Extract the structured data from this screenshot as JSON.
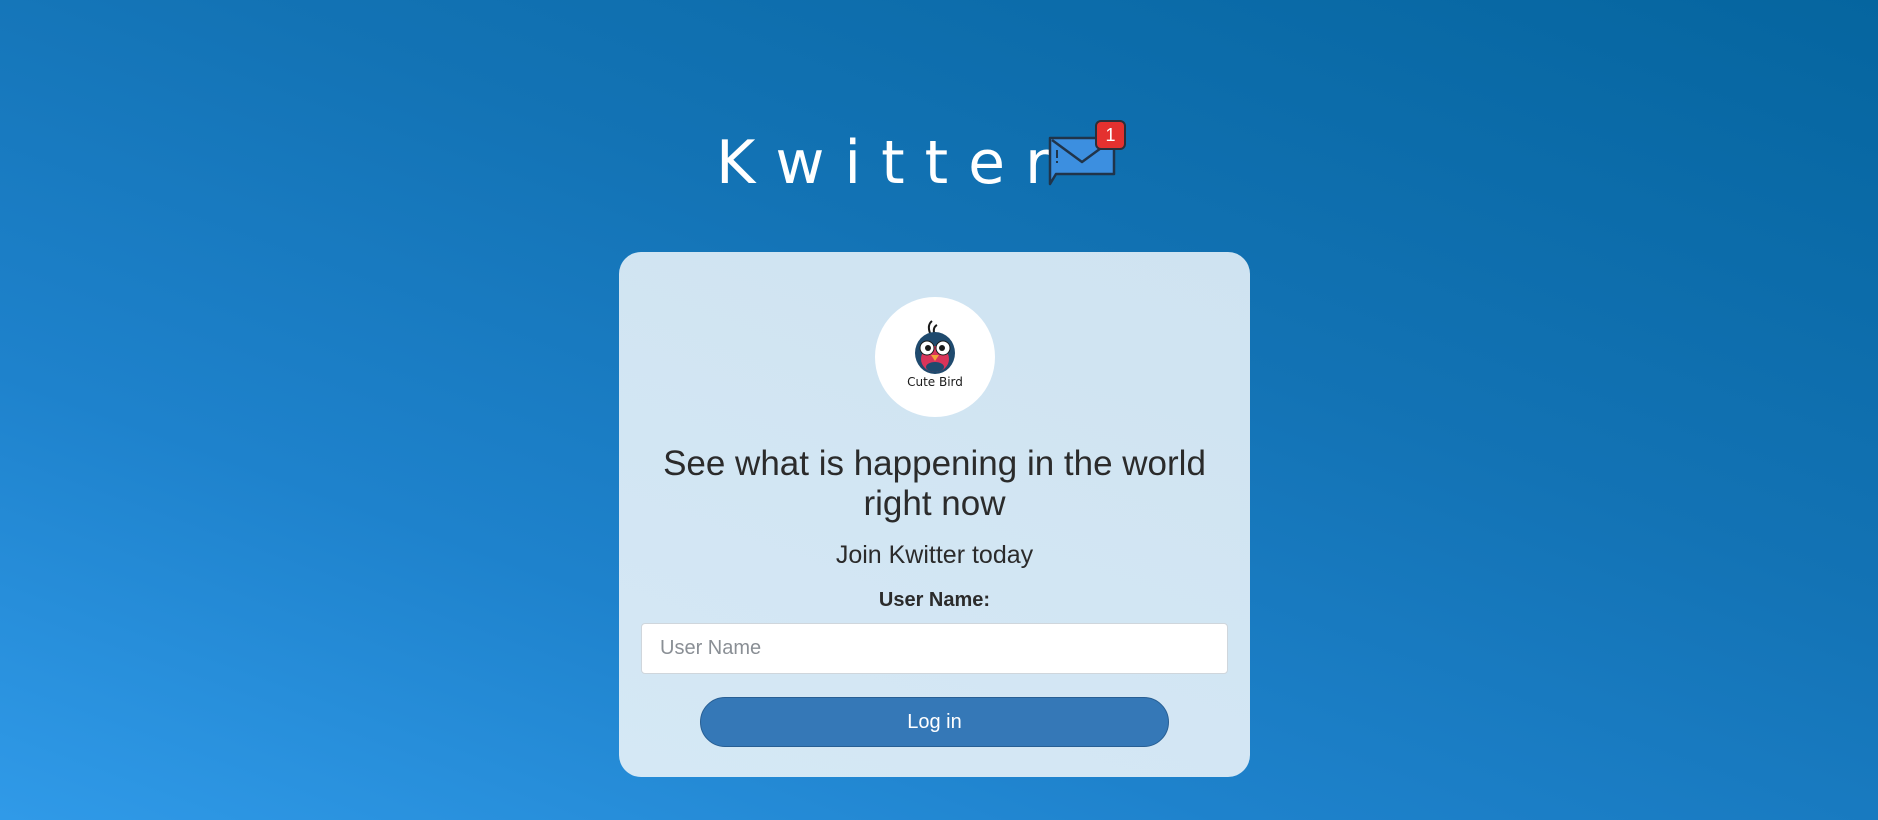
{
  "header": {
    "title": "Kwitter",
    "mail_icon": "envelope-icon",
    "notification_count": "1"
  },
  "card": {
    "avatar": {
      "icon": "cute-bird-logo",
      "caption": "Cute Bird"
    },
    "headline": "See what is happening in the world right now",
    "subhead": "Join Kwitter today",
    "username_label": "User Name:",
    "username_placeholder": "User Name",
    "username_value": "",
    "login_label": "Log in"
  },
  "colors": {
    "background_light": "#309ae8",
    "background_dark": "#05659f",
    "card": "#d3e6f3",
    "button": "#3578b7",
    "badge": "#e4312f",
    "envelope": "#3c8fe0"
  }
}
